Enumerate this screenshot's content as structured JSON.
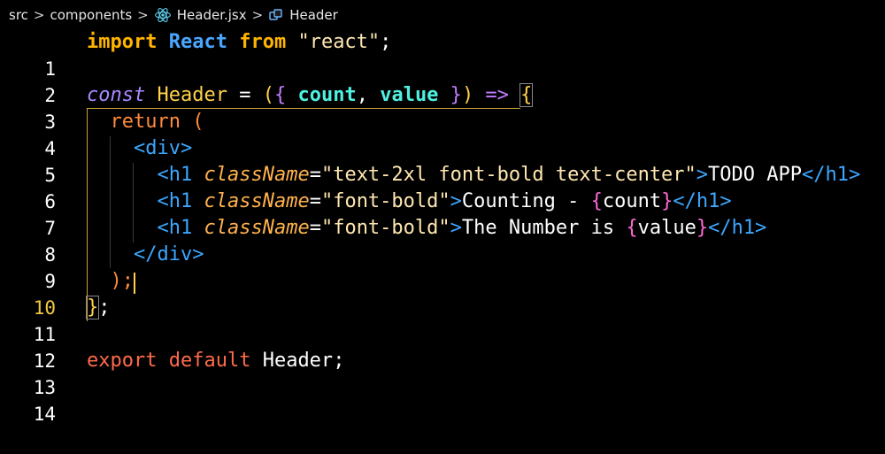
{
  "breadcrumb": {
    "items": [
      "src",
      "components",
      "Header.jsx",
      "Header"
    ],
    "separator": ">"
  },
  "editor": {
    "active_line": 10,
    "lines": [
      {
        "num": "1"
      },
      {
        "num": "2"
      },
      {
        "num": "3"
      },
      {
        "num": "4"
      },
      {
        "num": "5"
      },
      {
        "num": "6"
      },
      {
        "num": "7"
      },
      {
        "num": "8"
      },
      {
        "num": "9"
      },
      {
        "num": "10"
      },
      {
        "num": "11"
      },
      {
        "num": "12"
      },
      {
        "num": "13"
      },
      {
        "num": "14"
      }
    ],
    "tokens": {
      "import_kw": "import",
      "react_name": "React",
      "from_kw": "from",
      "react_str": "\"react\"",
      "semi": ";",
      "const_kw": "const",
      "component_name": "Header",
      "equals": " = ",
      "open_paren": "(",
      "open_obj": "{ ",
      "param_count": "count",
      "comma": ", ",
      "param_value": "value",
      "close_obj": " }",
      "close_paren": ")",
      "arrow": " => ",
      "open_brace": "{",
      "return_kw": "return",
      "return_paren": " (",
      "div_open": "<div>",
      "h1_open": "<h1",
      "class_attr": "className",
      "eq_sign": "=",
      "class_val_1": "\"text-2xl font-bold text-center\"",
      "class_val_2": "\"font-bold\"",
      "gt": ">",
      "title_text": "TODO APP",
      "h1_close": "</h1>",
      "counting_text": "Counting - ",
      "jsx_open": "{",
      "jsx_close": "}",
      "number_text": "The Number is ",
      "var_count": "count",
      "var_value": "value",
      "div_close": "</div>",
      "close_return": ");",
      "close_fn": "}",
      "export_kw": "export",
      "default_kw": "default",
      "export_name": "Header"
    }
  },
  "colors": {
    "background": "#000000",
    "active_line_number": "#f2c744",
    "keyword_blue": "#4aa6ff",
    "import_keyword": "#ffb400",
    "tag": "#3ca7ff",
    "attribute": "#ffb24d",
    "param": "#4ff0e1"
  },
  "icons": {
    "react": "react-icon",
    "symbol": "symbol-component-icon"
  }
}
